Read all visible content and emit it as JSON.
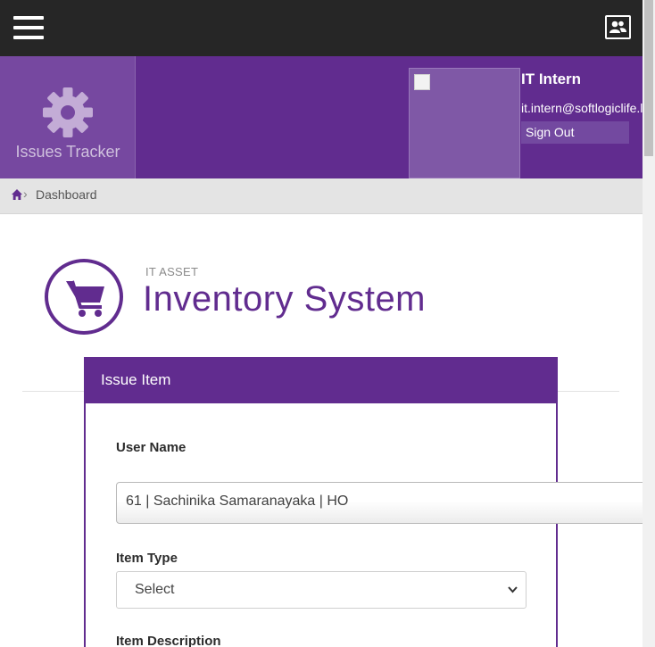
{
  "topbar": {
    "menu_icon": "hamburger-menu-icon",
    "contacts_icon": "contacts-card-icon"
  },
  "brand": {
    "icon": "gear-icon",
    "label": "Issues Tracker"
  },
  "user": {
    "name": "IT Intern",
    "email": "it.intern@softlogiclife.lk",
    "signout_label": "Sign Out"
  },
  "breadcrumb": {
    "home_icon": "home-icon",
    "current": "Dashboard"
  },
  "page": {
    "subtitle": "IT ASSET",
    "title": "Inventory System",
    "icon": "shopping-cart-icon"
  },
  "form": {
    "header": "Issue Item",
    "user_name_label": "User Name",
    "user_name_value": "61 | Sachinika Samaranayaka | HO",
    "item_type_label": "Item Type",
    "item_type_value": "Select",
    "item_description_label": "Item Description"
  },
  "colors": {
    "accent": "#612c8f",
    "topbar": "#262626",
    "brand_tile": "#7648a0"
  }
}
